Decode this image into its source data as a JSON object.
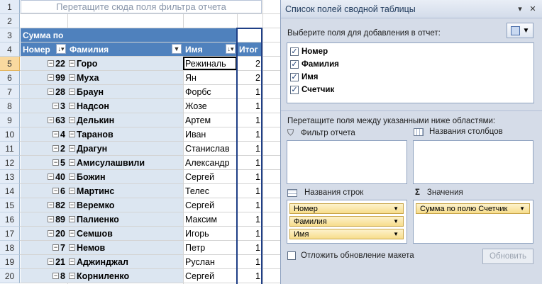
{
  "sheet": {
    "filter_hint": "Перетащите сюда поля фильтра отчета",
    "sum_header": "Сумма по",
    "col_headers": {
      "number": "Номер",
      "surname": "Фамилия",
      "name": "Имя",
      "total": "Итог"
    },
    "row_numbers": [
      "1",
      "2",
      "3",
      "4",
      "5",
      "6",
      "7",
      "8",
      "9",
      "10",
      "11",
      "12",
      "13",
      "14",
      "15",
      "16",
      "17",
      "18",
      "19",
      "20"
    ],
    "active_row": "5",
    "rows": [
      {
        "num": "22",
        "fam": "Горо",
        "name": "Режиналь",
        "itog": "2"
      },
      {
        "num": "99",
        "fam": "Муха",
        "name": "Ян",
        "itog": "2"
      },
      {
        "num": "28",
        "fam": "Браун",
        "name": "Форбс",
        "itog": "1"
      },
      {
        "num": "3",
        "fam": "Надсон",
        "name": "Жозе",
        "itog": "1"
      },
      {
        "num": "63",
        "fam": "Делькин",
        "name": "Артем",
        "itog": "1"
      },
      {
        "num": "4",
        "fam": "Таранов",
        "name": "Иван",
        "itog": "1"
      },
      {
        "num": "2",
        "fam": "Драгун",
        "name": "Станислав",
        "itog": "1"
      },
      {
        "num": "5",
        "fam": "Амисулашвили",
        "name": "Александр",
        "itog": "1"
      },
      {
        "num": "40",
        "fam": "Божин",
        "name": "Сергей",
        "itog": "1"
      },
      {
        "num": "6",
        "fam": "Мартинс",
        "name": "Телес",
        "itog": "1"
      },
      {
        "num": "82",
        "fam": "Веремко",
        "name": "Сергей",
        "itog": "1"
      },
      {
        "num": "89",
        "fam": "Палиенко",
        "name": "Максим",
        "itog": "1"
      },
      {
        "num": "20",
        "fam": "Семшов",
        "name": "Игорь",
        "itog": "1"
      },
      {
        "num": "7",
        "fam": "Немов",
        "name": "Петр",
        "itog": "1"
      },
      {
        "num": "21",
        "fam": "Аджинджал",
        "name": "Руслан",
        "itog": "1"
      },
      {
        "num": "8",
        "fam": "Корниленко",
        "name": "Сергей",
        "itog": "1"
      }
    ]
  },
  "panel": {
    "title": "Список полей сводной таблицы",
    "choose_label": "Выберите поля для добавления в отчет:",
    "fields": [
      {
        "label": "Номер",
        "checked": "✓"
      },
      {
        "label": "Фамилия",
        "checked": "✓"
      },
      {
        "label": "Имя",
        "checked": "✓"
      },
      {
        "label": "Счетчик",
        "checked": "✓"
      }
    ],
    "drag_label": "Перетащите поля между указанными ниже областями:",
    "area_filter": "Фильтр отчета",
    "area_columns": "Названия столбцов",
    "area_rows": "Названия строк",
    "area_values": "Значения",
    "values_sigma": "Σ",
    "row_chips": [
      "Номер",
      "Фамилия",
      "Имя"
    ],
    "value_chips": [
      "Сумма по полю Счетчик"
    ],
    "defer_label": "Отложить обновление макета",
    "update_button": "Обновить"
  }
}
